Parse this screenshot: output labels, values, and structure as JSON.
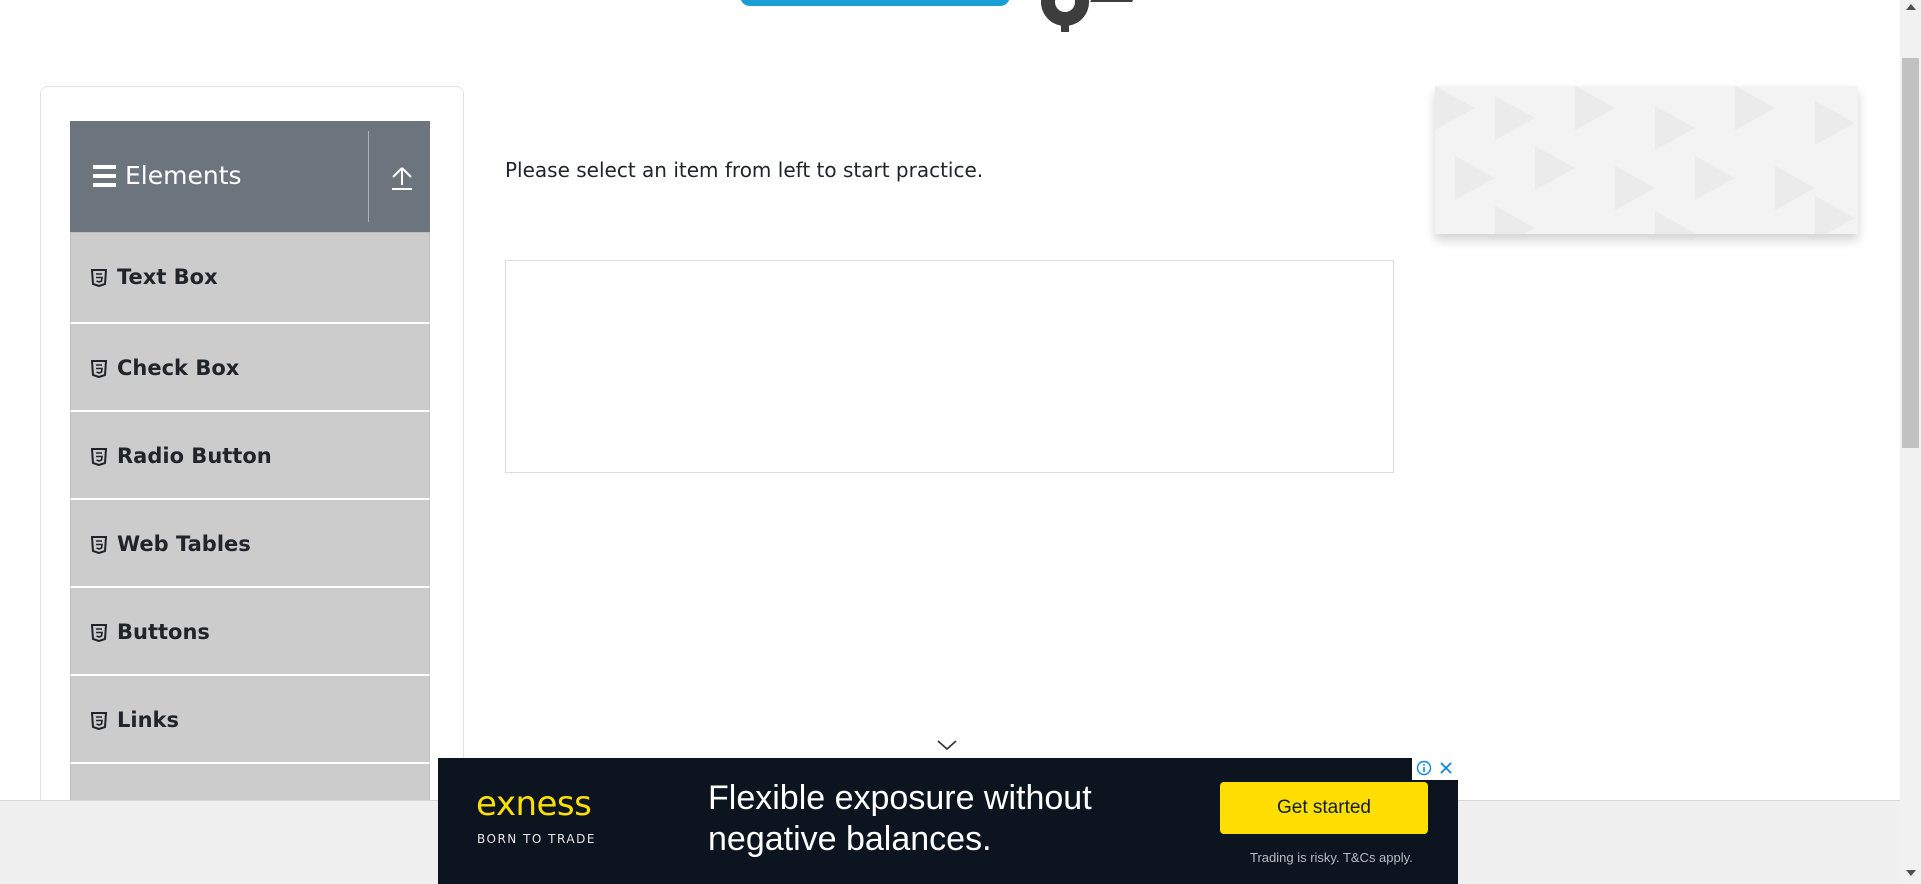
{
  "sidebar": {
    "group_title": "Elements",
    "items": [
      {
        "label": "Text Box"
      },
      {
        "label": "Check Box"
      },
      {
        "label": "Radio Button"
      },
      {
        "label": "Web Tables"
      },
      {
        "label": "Buttons"
      },
      {
        "label": "Links"
      }
    ]
  },
  "main": {
    "intro_text": "Please select an item from left to start practice."
  },
  "ad": {
    "brand": "exness",
    "tagline": "BORN TO TRADE",
    "headline": "Flexible exposure without negative balances.",
    "cta_label": "Get started",
    "disclaimer": "Trading is risky. T&Cs apply."
  },
  "colors": {
    "group_header_bg": "#6c757d",
    "menu_item_bg": "#cccccc",
    "logo_blue": "#1a9ed6",
    "ad_bg": "#0c1420",
    "ad_accent": "#ffde02"
  }
}
